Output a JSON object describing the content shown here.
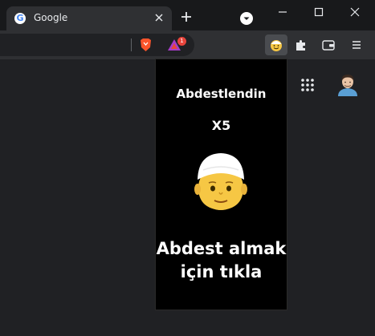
{
  "browser": {
    "tab": {
      "title": "Google",
      "favicon": "google-g-icon"
    },
    "rewards_badge": "1",
    "icons": {
      "new_tab": "plus-icon",
      "tab_search": "chevron-down-circle-icon",
      "minimize": "minimize-icon",
      "maximize": "maximize-icon",
      "close": "close-icon",
      "shield": "brave-shield-icon",
      "rewards": "brave-rewards-icon",
      "extension": "smiling-face-icon",
      "extensions_menu": "puzzle-icon",
      "wallet": "wallet-icon",
      "menu": "hamburger-menu-icon"
    }
  },
  "page": {
    "apps_icon": "apps-grid-icon",
    "avatar_icon": "user-avatar-icon"
  },
  "popup": {
    "title": "Abdestlendin",
    "count": "X5",
    "emoji": "man-with-white-cap-emoji",
    "action_line1": "Abdest almak",
    "action_line2": "için tıkla"
  },
  "colors": {
    "tabstrip_bg": "#18191b",
    "toolbar_bg": "#2f3033",
    "page_bg": "#202124",
    "popup_bg": "#000000",
    "popup_text": "#ffffff",
    "badge": "#e8453c"
  }
}
